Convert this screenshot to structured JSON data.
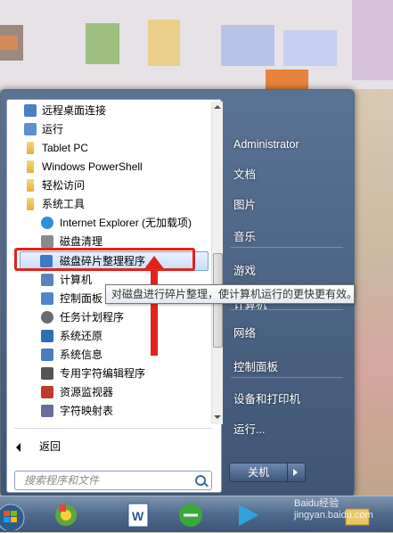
{
  "programs": [
    {
      "label": "远程桌面连接",
      "icon": "remote-desktop-icon",
      "sub": false
    },
    {
      "label": "运行",
      "icon": "run-icon",
      "sub": false
    },
    {
      "label": "Tablet PC",
      "icon": "folder-icon",
      "sub": false
    },
    {
      "label": "Windows PowerShell",
      "icon": "folder-icon",
      "sub": false
    },
    {
      "label": "轻松访问",
      "icon": "folder-icon",
      "sub": false
    },
    {
      "label": "系统工具",
      "icon": "folder-icon",
      "sub": false
    },
    {
      "label": "Internet Explorer (无加载项)",
      "icon": "ie-icon",
      "sub": true
    },
    {
      "label": "磁盘清理",
      "icon": "disk-cleanup-icon",
      "sub": true
    },
    {
      "label": "磁盘碎片整理程序",
      "icon": "defrag-icon",
      "sub": true,
      "highlighted": true
    },
    {
      "label": "计算机",
      "icon": "computer-icon",
      "sub": true
    },
    {
      "label": "控制面板",
      "icon": "control-panel-icon",
      "sub": true
    },
    {
      "label": "任务计划程序",
      "icon": "clock-icon",
      "sub": true
    },
    {
      "label": "系统还原",
      "icon": "system-restore-icon",
      "sub": true
    },
    {
      "label": "系统信息",
      "icon": "system-info-icon",
      "sub": true
    },
    {
      "label": "专用字符编辑程序",
      "icon": "char-editor-icon",
      "sub": true
    },
    {
      "label": "资源监视器",
      "icon": "resource-monitor-icon",
      "sub": true
    },
    {
      "label": "字符映射表",
      "icon": "char-map-icon",
      "sub": true
    }
  ],
  "back_label": "返回",
  "search_placeholder": "搜索程序和文件",
  "right_pane": [
    {
      "label": "Administrator"
    },
    {
      "label": "文档"
    },
    {
      "label": "图片"
    },
    {
      "label": "音乐"
    },
    {
      "label": "游戏"
    },
    {
      "label": "计算机"
    },
    {
      "label": "网络"
    },
    {
      "label": "控制面板"
    },
    {
      "label": "设备和打印机"
    },
    {
      "label": "运行..."
    }
  ],
  "shutdown_label": "关机",
  "tooltip": "对磁盘进行碎片整理，使计算机运行的更快更有效。",
  "watermark": "Baidu经验 jingyan.baidu.com",
  "colors": {
    "highlight": "#c7ddf7",
    "annotation": "#e3221b",
    "menu_bg": "#4a6383"
  }
}
